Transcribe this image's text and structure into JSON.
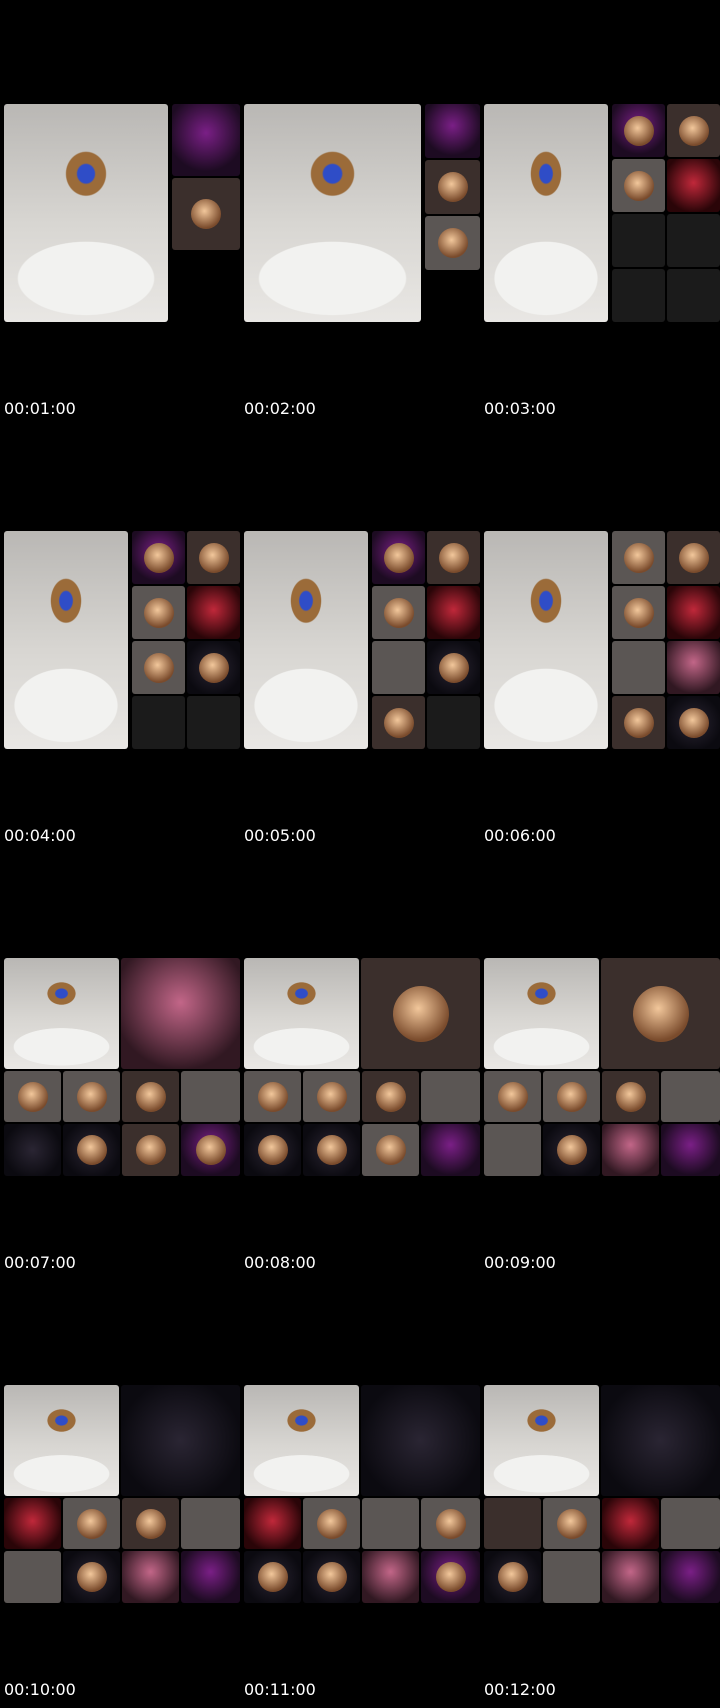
{
  "frames": [
    {
      "timestamp": "00:01:00"
    },
    {
      "timestamp": "00:02:00"
    },
    {
      "timestamp": "00:03:00"
    },
    {
      "timestamp": "00:04:00"
    },
    {
      "timestamp": "00:05:00"
    },
    {
      "timestamp": "00:06:00"
    },
    {
      "timestamp": "00:07:00"
    },
    {
      "timestamp": "00:08:00"
    },
    {
      "timestamp": "00:09:00"
    },
    {
      "timestamp": "00:10:00"
    },
    {
      "timestamp": "00:11:00"
    },
    {
      "timestamp": "00:12:00"
    }
  ]
}
